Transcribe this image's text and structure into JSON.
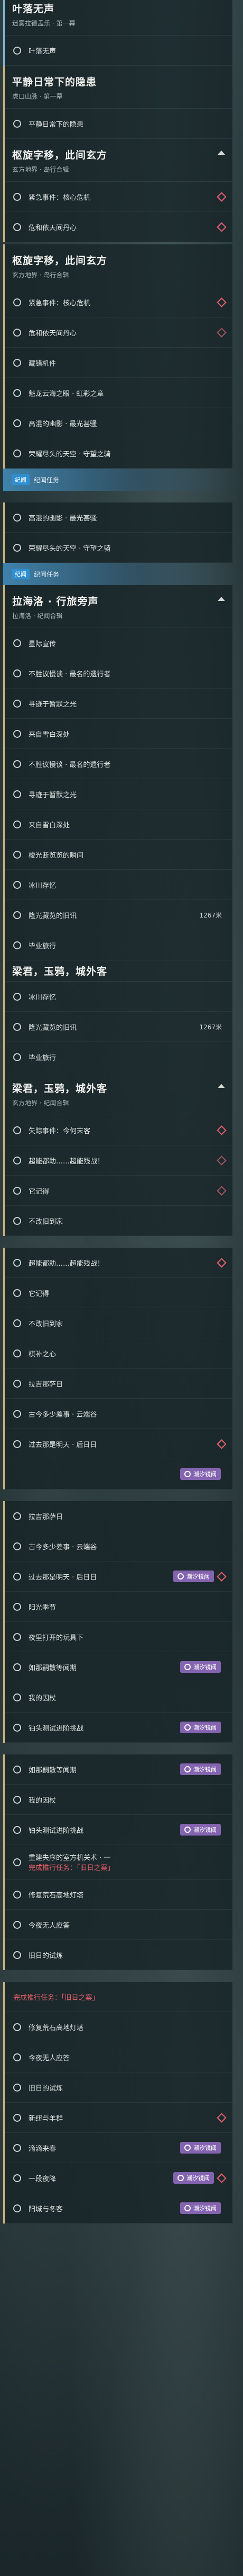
{
  "g1": {
    "title": "平静日常下的隐患",
    "sub": "虎口山脉 · 第一幕",
    "top_title": "叶落无声",
    "top_sub": "迷雾拉德孟乐 · 第一幕",
    "top_row": "叶落无声",
    "rows": [
      "平静日常下的隐患"
    ]
  },
  "g2": {
    "title": "枢旋字移，此间玄方",
    "sub": "玄方地界 · 岛行合辑",
    "rows": [
      "紧急事件：核心危机",
      "危和依天间丹心"
    ]
  },
  "g3": {
    "title": "枢旋字移，此间玄方",
    "sub": "玄方地界 · 岛行合辑",
    "rows": [
      "紧急事件：核心危机",
      "危和依天间丹心",
      "藏错机件",
      "魁龙云海之眼 · 虹彩之章",
      "高混的幽影 · 最光甚骚",
      "荣耀尽头的天空 · 守望之骑"
    ]
  },
  "sec1": {
    "tag": "纪闻",
    "label": "纪闻任务"
  },
  "g4_rows": [
    "高混的幽影 · 最光甚骚",
    "荣耀尽头的天空 · 守望之骑"
  ],
  "sec2": {
    "tag": "纪闻",
    "label": "纪闻任务"
  },
  "g5": {
    "title": "拉海洛 · 行旅旁声",
    "sub": "拉海洛 · 纪闻合辑",
    "rows": [
      "星际宣传",
      "不胜议慢谈 · 最名的遗行者",
      "寻迹于暂默之光",
      "来自雪白深处",
      "不胜议慢谈 · 最名的遗行者",
      "寻迹于暂默之光",
      "来自雪白深处",
      "梭光断览览的瞬间",
      "冰川存忆",
      "隆光藏览的旧讯",
      "毕业旅行"
    ],
    "dist": "1267米"
  },
  "g6": {
    "cut_title": "梁君，玉鸦，城外客",
    "pre_rows": [
      "冰川存忆",
      "隆光藏览的旧讯",
      "毕业旅行"
    ],
    "dist": "1267米",
    "title": "梁君，玉鸦，城外客",
    "sub": "玄方地界 · 纪闻合辑",
    "rows": [
      "失踪事件：今何末客",
      "超能都助……超能残战！",
      "它记得",
      "不改旧到家"
    ]
  },
  "g7_rows": [
    "超能都助……超能残战！",
    "它记得",
    "不改旧到家",
    "棋补之心",
    "拉吉那萨日",
    "古今多少差事 · 云端谷",
    "过去那是明天 · 后日日"
  ],
  "badge": "潮汐镜阈",
  "g8_rows": [
    "拉吉那萨日",
    "古今多少差事 · 云端谷",
    "过去那是明天 · 后日日",
    "阳光季节",
    "夜里打开的玩具下",
    "如那嗣散等闻期",
    "我的因杖",
    "铂头测试进阶挑战"
  ],
  "g9_rows": [
    "如那嗣散等闻期",
    "我的因杖",
    "铂头测试进阶挑战",
    "重建失序的室方机关术 · 一",
    "修复荒石高地灯塔",
    "今夜无人应答",
    "旧日的试炼"
  ],
  "g9_warn": "完成推行任务：「旧日之案」",
  "g10_warn": "完成推行任务：「旧日之案」",
  "g10_rows": [
    "修复荒石高地灯塔",
    "今夜无人应答",
    "旧日的试炼",
    "新纽与羊群",
    "滴滴来春",
    "一段夜降",
    "阳城与冬客"
  ]
}
